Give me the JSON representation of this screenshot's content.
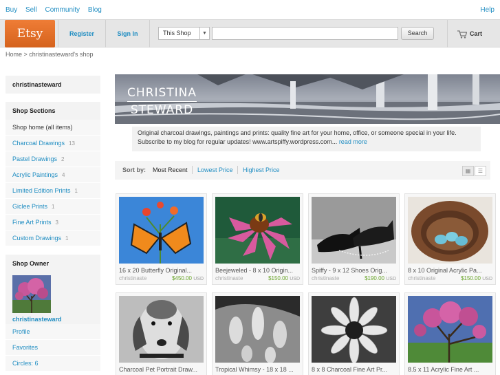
{
  "topnav": {
    "buy": "Buy",
    "sell": "Sell",
    "community": "Community",
    "blog": "Blog",
    "help": "Help"
  },
  "header": {
    "logo": "Etsy",
    "register": "Register",
    "signin": "Sign In",
    "scope": "This Shop",
    "search_value": "",
    "search_button": "Search",
    "cart": "Cart"
  },
  "breadcrumb": "Home > christinasteward's shop",
  "sidebar": {
    "shop_name": "christinasteward",
    "sections_title": "Shop Sections",
    "sections": [
      {
        "label": "Shop home (all items)",
        "count": ""
      },
      {
        "label": "Charcoal Drawings",
        "count": "13"
      },
      {
        "label": "Pastel Drawings",
        "count": "2"
      },
      {
        "label": "Acrylic Paintings",
        "count": "4"
      },
      {
        "label": "Limited Edition Prints",
        "count": "1"
      },
      {
        "label": "Giclee Prints",
        "count": "1"
      },
      {
        "label": "Fine Art Prints",
        "count": "3"
      },
      {
        "label": "Custom Drawings",
        "count": "1"
      }
    ],
    "owner_title": "Shop Owner",
    "owner_name": "christinasteward",
    "owner_links": [
      "Profile",
      "Favorites",
      "Circles: 6"
    ]
  },
  "banner": {
    "line1": "CHRISTINA",
    "line2": "STEWARD"
  },
  "description": {
    "text": "Original charcoal drawings, paintings and prints: quality fine art for your home, office, or someone special in your life. Subscribe to my blog for regular updates! www.artspiffy.wordpress.com...",
    "more": "read more"
  },
  "sort": {
    "label": "Sort by:",
    "options": [
      "Most Recent",
      "Lowest Price",
      "Highest Price"
    ],
    "active": "Most Recent"
  },
  "listings": [
    {
      "title": "16 x 20 Butterfly Original...",
      "seller": "christinaste",
      "price": "$450.00",
      "currency": "USD"
    },
    {
      "title": "Beejeweled - 8 x 10 Origin...",
      "seller": "christinaste",
      "price": "$150.00",
      "currency": "USD"
    },
    {
      "title": "Spiffy - 9 x 12 Shoes Orig...",
      "seller": "christinaste",
      "price": "$190.00",
      "currency": "USD"
    },
    {
      "title": "8 x 10 Original Acrylic Pa...",
      "seller": "christinaste",
      "price": "$150.00",
      "currency": "USD"
    },
    {
      "title": "Charcoal Pet Portrait Draw...",
      "seller": "",
      "price": "",
      "currency": ""
    },
    {
      "title": "Tropical Whimsy - 18 x 18 ...",
      "seller": "",
      "price": "",
      "currency": ""
    },
    {
      "title": "8 x 8 Charcoal Fine Art Pr...",
      "seller": "",
      "price": "",
      "currency": ""
    },
    {
      "title": "8.5 x 11 Acrylic Fine Art ...",
      "seller": "",
      "price": "",
      "currency": ""
    }
  ],
  "colors": {
    "link": "#1f8dc2",
    "brand": "#e56f27",
    "price": "#6aa52b"
  }
}
